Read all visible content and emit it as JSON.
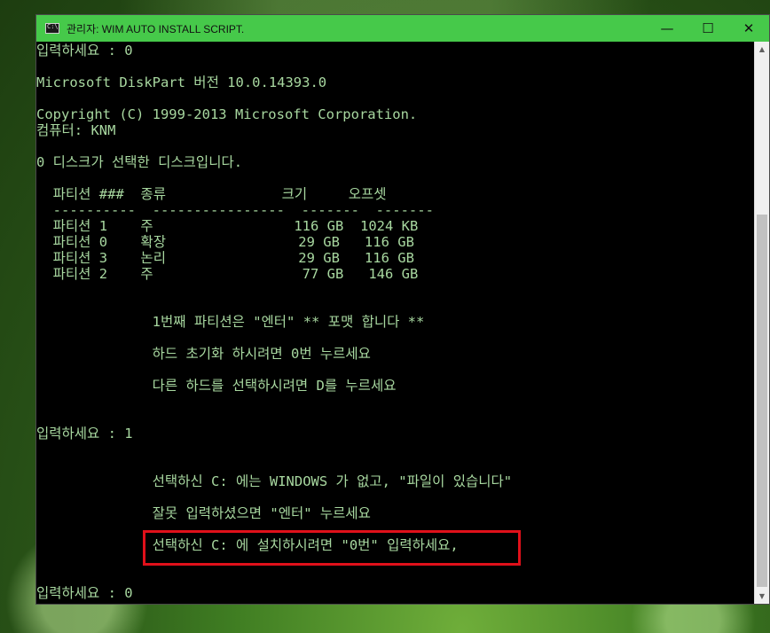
{
  "window": {
    "title": "관리자:  WIM AUTO INSTALL SCRIPT.",
    "controls": {
      "minimize": "—",
      "maximize": "☐",
      "close": "✕"
    }
  },
  "console": {
    "lines": [
      "입력하세요 : 0",
      "",
      "Microsoft DiskPart 버전 10.0.14393.0",
      "",
      "Copyright (C) 1999-2013 Microsoft Corporation.",
      "컴퓨터: KNM",
      "",
      "0 디스크가 선택한 디스크입니다.",
      "",
      "  파티션 ###  종류              크기     오프셋",
      "  ----------  ----------------  -------  -------",
      "  파티션 1    주                 116 GB  1024 KB",
      "  파티션 0    확장                29 GB   116 GB",
      "  파티션 3    논리                29 GB   116 GB",
      "  파티션 2    주                  77 GB   146 GB",
      "",
      "",
      "              1번째 파티션은 \"엔터\" ** 포맷 합니다 **",
      "",
      "              하드 초기화 하시려면 0번 누르세요",
      "",
      "              다른 하드를 선택하시려면 D를 누르세요",
      "",
      "",
      "입력하세요 : 1",
      "",
      "",
      "              선택하신 C: 에는 WINDOWS 가 없고, \"파일이 있습니다\"",
      "",
      "              잘못 입력하셨으면 \"엔터\" 누르세요",
      "",
      "              선택하신 C: 에 설치하시려면 \"0번\" 입력하세요,",
      "",
      "",
      "입력하세요 : 0"
    ]
  },
  "colors": {
    "titlebar": "#46c94a",
    "console_bg": "#000000",
    "console_text": "#a8d8a0",
    "highlight": "#e0101a"
  }
}
